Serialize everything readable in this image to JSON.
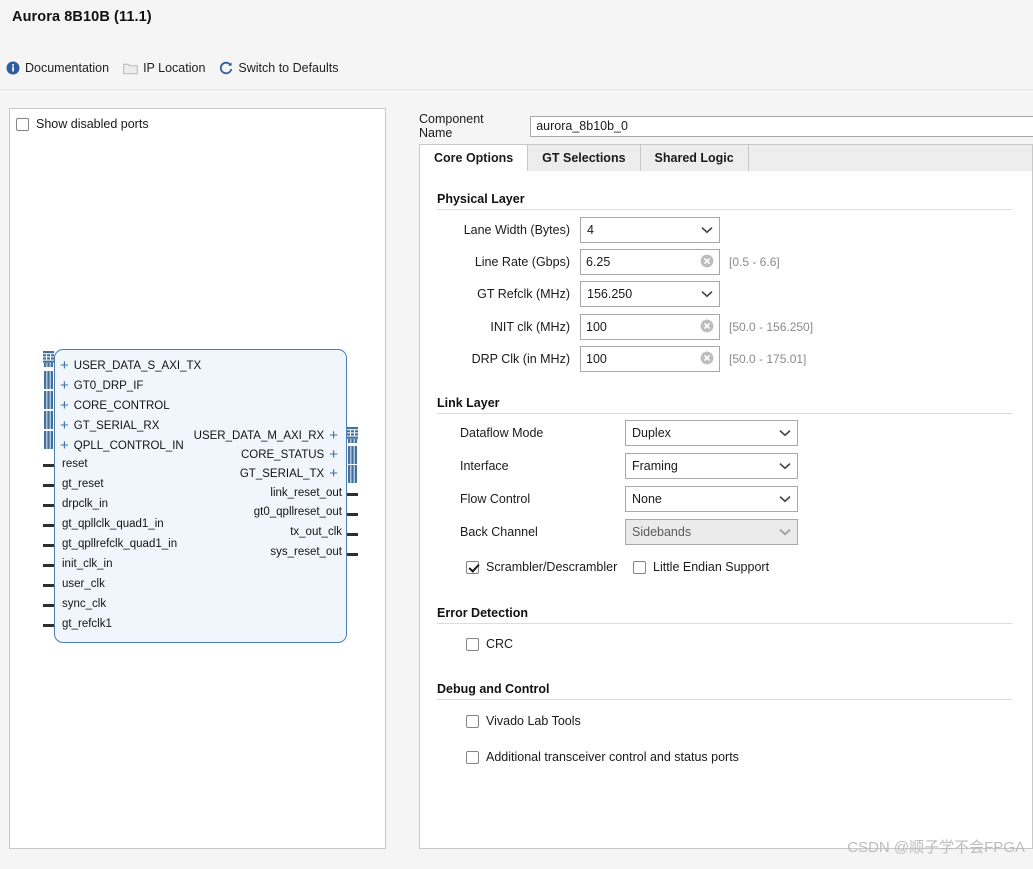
{
  "dialog": {
    "title": "Aurora 8B10B (11.1)"
  },
  "toolbar": {
    "items": [
      {
        "label": "Documentation",
        "icon": "info-icon",
        "enabled": true
      },
      {
        "label": "IP Location",
        "icon": "folder-icon",
        "enabled": false
      },
      {
        "label": "Switch to Defaults",
        "icon": "refresh-icon",
        "enabled": true
      }
    ]
  },
  "left_panel": {
    "show_disabled_ports": {
      "label": "Show disabled ports",
      "checked": false
    },
    "diagram": {
      "left_buses": [
        "USER_DATA_S_AXI_TX",
        "GT0_DRP_IF",
        "CORE_CONTROL",
        "GT_SERIAL_RX",
        "QPLL_CONTROL_IN"
      ],
      "left_pins": [
        "reset",
        "gt_reset",
        "drpclk_in",
        "gt_qpllclk_quad1_in",
        "gt_qpllrefclk_quad1_in",
        "init_clk_in",
        "user_clk",
        "sync_clk",
        "gt_refclk1"
      ],
      "right_buses": [
        "USER_DATA_M_AXI_RX",
        "CORE_STATUS",
        "GT_SERIAL_TX"
      ],
      "right_pins": [
        "link_reset_out",
        "gt0_qpllreset_out",
        "tx_out_clk",
        "sys_reset_out"
      ]
    }
  },
  "right_panel": {
    "component_name": {
      "label": "Component Name",
      "value": "aurora_8b10b_0"
    },
    "tabs": [
      {
        "label": "Core Options",
        "active": true
      },
      {
        "label": "GT Selections",
        "active": false
      },
      {
        "label": "Shared Logic",
        "active": false
      }
    ],
    "sections": {
      "physical_layer": {
        "title": "Physical Layer",
        "fields": [
          {
            "label": "Lane Width (Bytes)",
            "type": "combo",
            "value": "4",
            "range": ""
          },
          {
            "label": "Line Rate (Gbps)",
            "type": "text",
            "value": "6.25",
            "range": "[0.5 - 6.6]"
          },
          {
            "label": "GT Refclk (MHz)",
            "type": "combo",
            "value": "156.250",
            "range": ""
          },
          {
            "label": "INIT clk (MHz)",
            "type": "text",
            "value": "100",
            "range": "[50.0 - 156.250]"
          },
          {
            "label": "DRP Clk (in MHz)",
            "type": "text",
            "value": "100",
            "range": "[50.0 - 175.01]"
          }
        ]
      },
      "link_layer": {
        "title": "Link Layer",
        "fields": [
          {
            "label": "Dataflow Mode",
            "type": "combo",
            "value": "Duplex",
            "disabled": false
          },
          {
            "label": "Interface",
            "type": "combo",
            "value": "Framing",
            "disabled": false
          },
          {
            "label": "Flow Control",
            "type": "combo",
            "value": "None",
            "disabled": false
          },
          {
            "label": "Back Channel",
            "type": "combo",
            "value": "Sidebands",
            "disabled": true
          }
        ],
        "checkboxes": [
          {
            "label": "Scrambler/Descrambler",
            "checked": true
          },
          {
            "label": "Little Endian Support",
            "checked": false
          }
        ]
      },
      "error_detection": {
        "title": "Error Detection",
        "checkboxes": [
          {
            "label": "CRC",
            "checked": false
          }
        ]
      },
      "debug_and_control": {
        "title": "Debug and Control",
        "checkboxes": [
          {
            "label": "Vivado Lab Tools",
            "checked": false
          },
          {
            "label": "Additional transceiver control and status ports",
            "checked": false
          }
        ]
      }
    }
  },
  "watermark": {
    "text": "CSDN @顺子学不会FPGA"
  },
  "colors": {
    "accent_blue": "#2d5d9c",
    "block_border": "#4b7eb4",
    "block_fill": "#f1f6fc",
    "range_gray": "#8a8a8a"
  }
}
